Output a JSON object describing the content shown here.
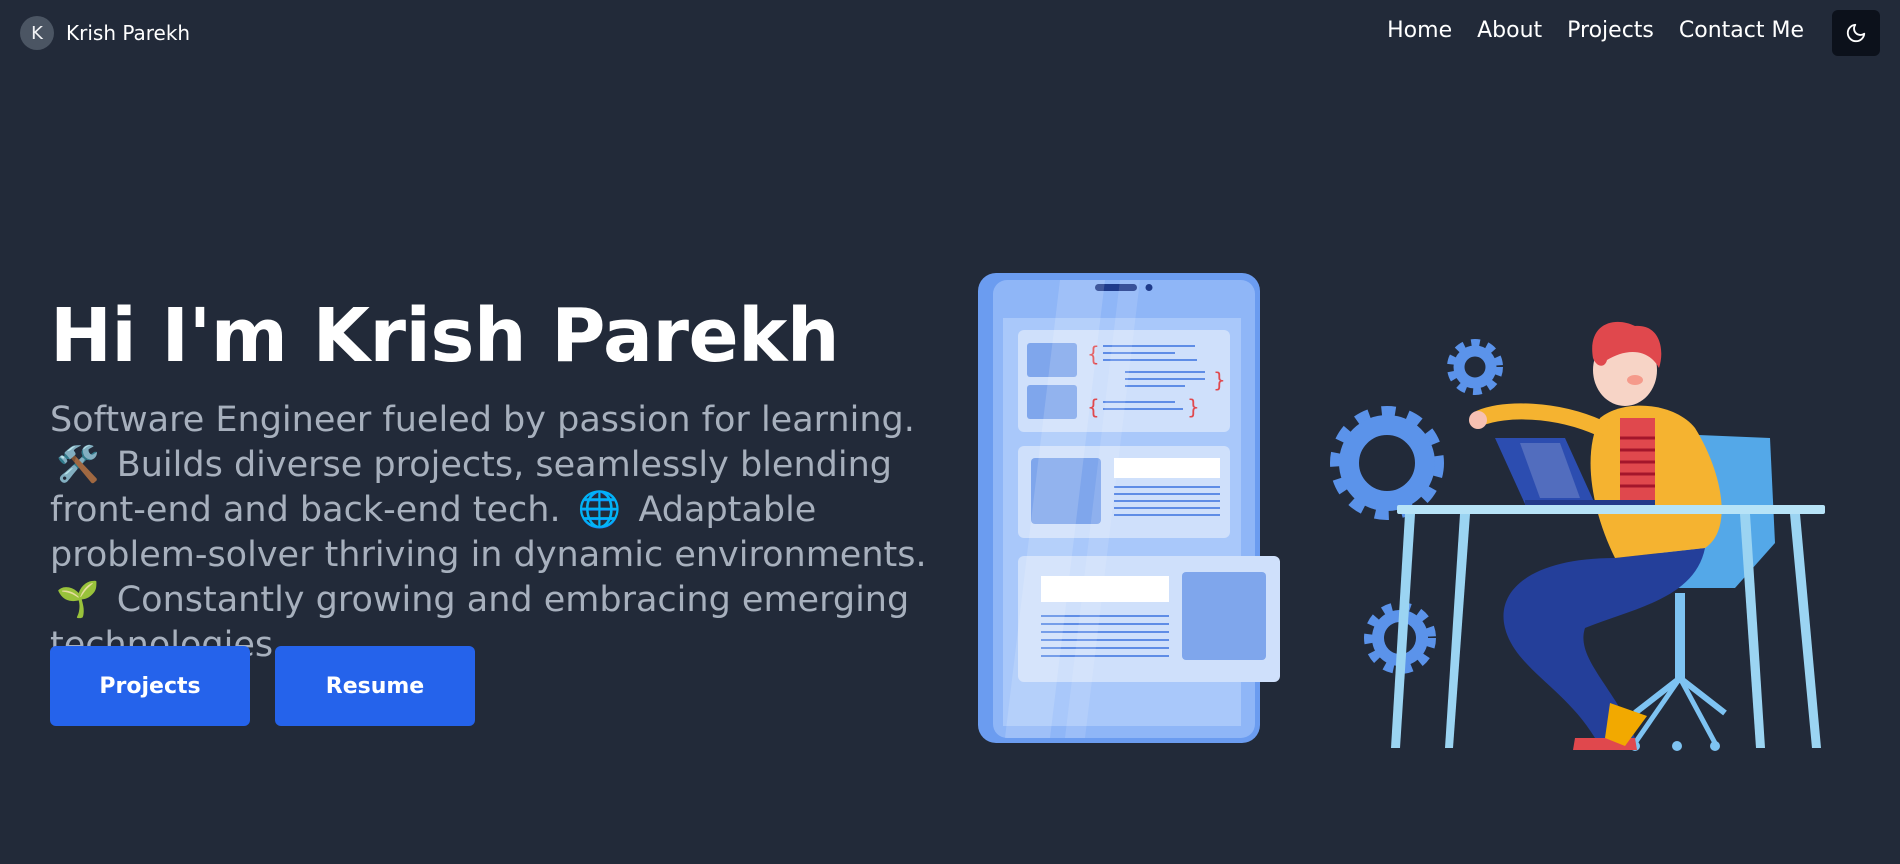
{
  "nav": {
    "avatar_initial": "K",
    "brand_name": "Krish Parekh",
    "links": [
      "Home",
      "About",
      "Projects",
      "Contact Me"
    ],
    "theme_icon": "moon-icon"
  },
  "hero": {
    "title": "Hi I'm Krish Parekh",
    "desc": {
      "part1": "Software Engineer fueled by passion for learning.",
      "emoji1": "🛠️",
      "part2": "Builds diverse projects, seamlessly blending front-end and back-end tech.",
      "emoji2": "🌐",
      "part3": "Adaptable problem-solver thriving in dynamic environments.",
      "emoji3": "🌱",
      "part4": "Constantly growing and embracing emerging technologies."
    },
    "buttons": {
      "projects": "Projects",
      "resume": "Resume"
    }
  },
  "colors": {
    "background": "#222a39",
    "accent": "#2563eb",
    "muted_text": "#a7b0bd"
  }
}
